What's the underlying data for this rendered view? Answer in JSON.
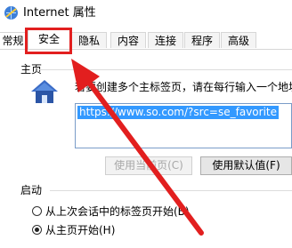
{
  "window": {
    "title": "Internet 属性",
    "icon": "internet-options-icon"
  },
  "tabs": [
    {
      "label": "常规",
      "selected": false
    },
    {
      "label": "安全",
      "selected": true
    },
    {
      "label": "隐私",
      "selected": false
    },
    {
      "label": "内容",
      "selected": false
    },
    {
      "label": "连接",
      "selected": false
    },
    {
      "label": "程序",
      "selected": false
    },
    {
      "label": "高级",
      "selected": false
    }
  ],
  "homepage": {
    "group_label": "主页",
    "icon": "home-icon",
    "description": "若要创建多个主标签页，请在每行输入一个地址(R)",
    "url_value": "https://www.so.com/?src=se_favorite",
    "buttons": {
      "use_current": "使用当前页(C)",
      "use_default": "使用默认值(F)"
    }
  },
  "startup": {
    "group_label": "启动",
    "options": [
      {
        "label": "从上次会话中的标签页开始(B)",
        "checked": false
      },
      {
        "label": "从主页开始(H)",
        "checked": true
      }
    ]
  },
  "annotation": {
    "highlight_color": "#e21f1f",
    "pointer": "red-arrow"
  },
  "colors": {
    "selection": "#3399ff",
    "accent": "#e21f1f"
  }
}
